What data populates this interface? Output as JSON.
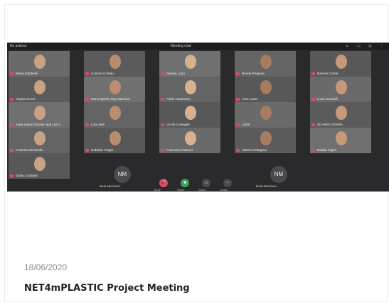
{
  "toolbar": {
    "left_label": "Rs actions",
    "center_label": "Meeting chat",
    "right_icons": [
      "people-icon",
      "chat-icon",
      "view-icon",
      "more-icon"
    ]
  },
  "participants": [
    "Elena Zambello",
    "Corinne Corbau",
    "Alessio Lupo",
    "Nenda Pisajevic",
    "Daniele Cutine",
    "Virginia Rocci",
    "Mario Sperlic Neja Marlovic",
    "Fabio Cadamuro",
    "Aura Lazar",
    "Lucia Gandolfi",
    "Jasia Sokan Vucevic and Lea V",
    "Luca Neri",
    "Cinzia Colangeli",
    "Lbdaf",
    "SCHMID CHIARA",
    "Federica Seminello",
    "Gabriele Fregni",
    "Francesco Falconi",
    "Alberto Pellegrino",
    "Natalia Cigini",
    "Giulia a Gianini"
  ],
  "avatars": [
    {
      "initials": "NM",
      "name": "Nela Marclevic"
    },
    {
      "initials": "NM",
      "name": "Nela Marclevic"
    }
  ],
  "controls": [
    {
      "label": "Mute",
      "color": "#e04a5f"
    },
    {
      "label": "Video",
      "color": "#3aa35b"
    },
    {
      "label": "Share",
      "color": "#4a4a4e"
    },
    {
      "label": "Leave",
      "color": "#4a4a4e"
    }
  ],
  "post": {
    "date": "18/06/2020",
    "title": "NET4mPLASTIC Project Meeting"
  }
}
